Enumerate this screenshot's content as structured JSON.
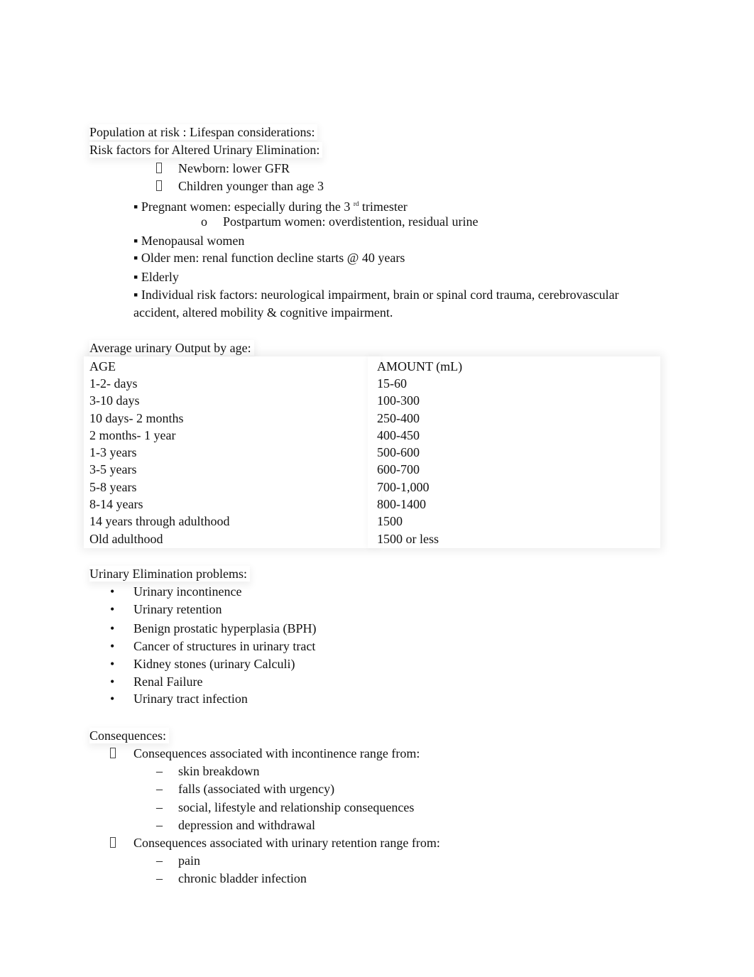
{
  "section1": {
    "heading1": "Population at risk : Lifespan considerations:",
    "heading2": "Risk factors for Altered Urinary Elimination:",
    "box_items": [
      "Newborn: lower GFR",
      "Children younger than age 3"
    ],
    "pregnant_pre": "Pregnant women: especially during the 3",
    "pregnant_sup": "rd",
    "pregnant_post": "trimester",
    "sub_bullet": "o",
    "postpartum": "Postpartum women: overdistention, residual urine",
    "square_items": [
      "Menopausal women",
      "Older men: renal function decline starts @ 40 years",
      "Elderly",
      "Individual risk factors: neurological impairment, brain or spinal cord trauma, cerebrovascular"
    ],
    "continuation": "accident, altered mobility & cognitive impairment."
  },
  "table": {
    "title": "Average urinary Output by age:",
    "headers": [
      "AGE",
      "AMOUNT (mL)"
    ],
    "rows": [
      [
        "1-2- days",
        "15-60"
      ],
      [
        "3-10 days",
        "100-300"
      ],
      [
        "10 days- 2 months",
        "250-400"
      ],
      [
        "2 months- 1 year",
        "400-450"
      ],
      [
        "1-3 years",
        "500-600"
      ],
      [
        "3-5 years",
        "600-700"
      ],
      [
        "5-8 years",
        "700-1,000"
      ],
      [
        "8-14 years",
        "800-1400"
      ],
      [
        "14 years through adulthood",
        "1500"
      ],
      [
        "Old adulthood",
        "1500 or less"
      ]
    ]
  },
  "problems": {
    "heading": "Urinary Elimination problems:",
    "items": [
      "Urinary incontinence",
      "Urinary retention",
      "Benign prostatic hyperplasia (BPH)",
      "Cancer of structures in urinary tract",
      "Kidney stones (urinary Calculi)",
      "Renal Failure",
      "Urinary tract infection"
    ]
  },
  "consequences": {
    "heading": "Consequences:",
    "groups": [
      {
        "label": "Consequences associated with  incontinence  range from:",
        "items": [
          "skin breakdown",
          "falls (associated with urgency)",
          "social, lifestyle and relationship consequences",
          "depression and withdrawal"
        ]
      },
      {
        "label": "Consequences associated with  urinary retention   range from:",
        "items": [
          "pain",
          "chronic bladder infection"
        ]
      }
    ]
  }
}
